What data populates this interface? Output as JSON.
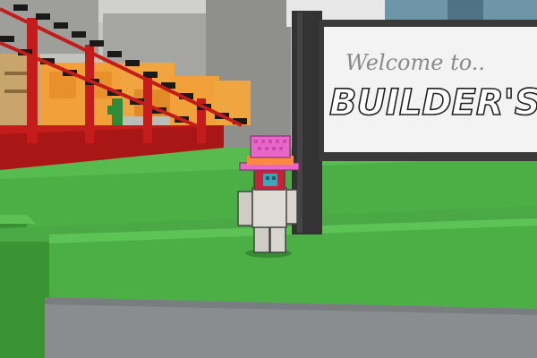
{
  "sign": {
    "line1": "Welcome to..",
    "line2": "BUILDER'S CO"
  },
  "colors": {
    "ground": "#4caf45",
    "ground_dark": "#3e9a39",
    "ground_shadow": "#2f7d2c",
    "cliff": "#8a8d8f",
    "wall": "#a9a9a9",
    "stairs_red": "#c41b1b",
    "stairs_black": "#1a1a1a",
    "crates_orange": "#f2a03a",
    "sign_frame": "#333333",
    "sign_board": "#f3f3f3",
    "hat_pink": "#e866c8",
    "hat_band": "#ff8a3d",
    "avatar_body": "#d9d6cf"
  },
  "entities": {
    "player_avatar": "blocky-avatar-with-pink-top-hat",
    "sign_post": "welcome-sign",
    "decor_item": "cactus-plant"
  }
}
